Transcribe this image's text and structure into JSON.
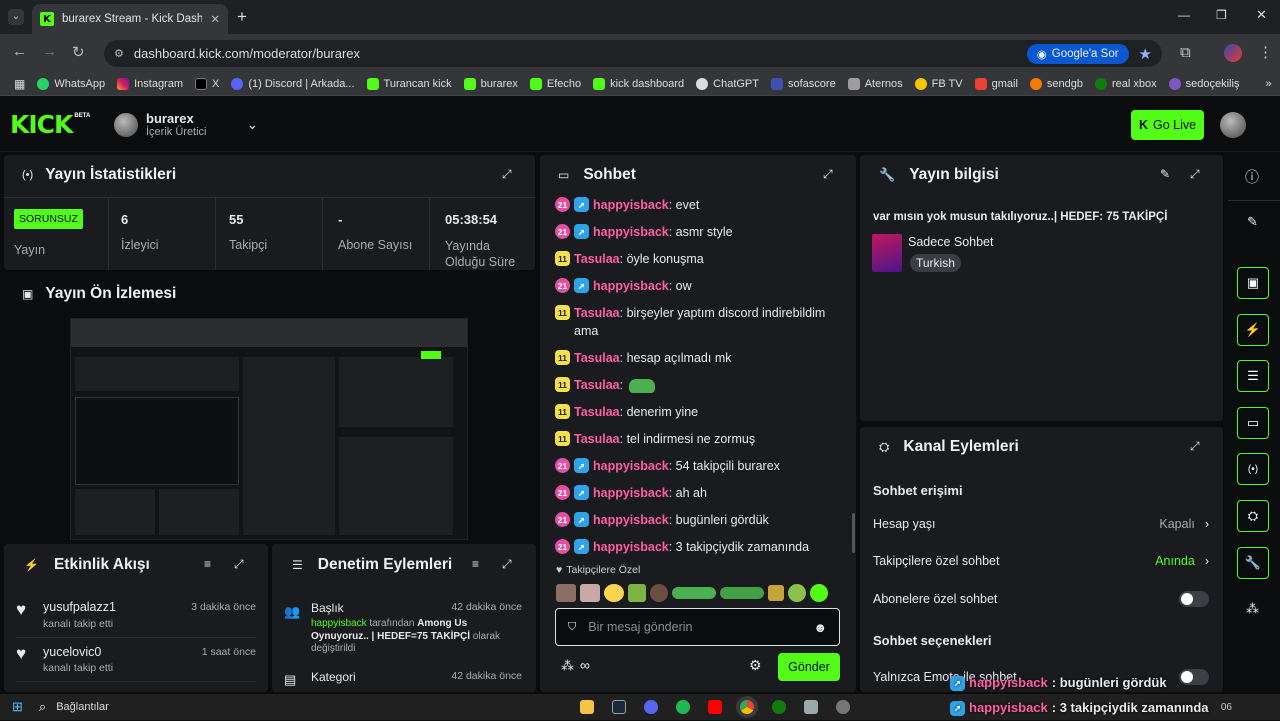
{
  "browser": {
    "tab_title": "burarex Stream - Kick Dashboar",
    "url": "dashboard.kick.com/moderator/burarex",
    "google_ask": "Google'a Sor",
    "bookmarks": [
      "WhatsApp",
      "Instagram",
      "X",
      "(1) Discord | Arkada...",
      "Turancan kick",
      "burarex",
      "Efecho",
      "kick dashboard",
      "ChatGPT",
      "sofascore",
      "Aternos",
      "FB TV",
      "gmail",
      "sendgb",
      "real xbox",
      "sedoçekiliş"
    ]
  },
  "header": {
    "logo": "KICK",
    "logo_beta": "BETA",
    "username": "burarex",
    "role": "İçerik Üretici",
    "go_live": "Go Live"
  },
  "stats": {
    "title": "Yayın İstatistikleri",
    "status_badge": "SORUNSUZ",
    "status_label": "Yayın",
    "viewers_value": "6",
    "viewers_label": "İzleyici",
    "followers_value": "55",
    "followers_label": "Takipçi",
    "subs_value": "-",
    "subs_label": "Abone Sayısı",
    "duration_value": "05:38:54",
    "duration_label": "Yayında Olduğu Süre"
  },
  "preview": {
    "title": "Yayın Ön İzlemesi"
  },
  "activity": {
    "title": "Etkinlik Akışı",
    "items": [
      {
        "user": "yusufpalazz1",
        "action": "kanalı takip etti",
        "time": "3 dakika önce"
      },
      {
        "user": "yucelovic0",
        "action": "kanalı takip etti",
        "time": "1 saat önce"
      }
    ]
  },
  "moderation": {
    "title": "Denetim Eylemleri",
    "item1_title": "Başlık",
    "item1_time": "42 dakika önce",
    "item1_user": "happyisback",
    "item1_text1": " tarafından ",
    "item1_new_title": "Among Us Oynuyoruz.. | HEDEF=75 TAKİPÇİ",
    "item1_text2": " olarak değiştirildi",
    "item2_title": "Kategori",
    "item2_time": "42 dakika önce"
  },
  "chat": {
    "title": "Sohbet",
    "messages": [
      {
        "badge": "21",
        "user": "happyisback",
        "text": ": evet"
      },
      {
        "badge": "21",
        "user": "happyisback",
        "text": ": asmr style"
      },
      {
        "badge": "11",
        "user": "Tasulaa",
        "text": ": öyle konuşma"
      },
      {
        "badge": "21",
        "user": "happyisback",
        "text": ": ow"
      },
      {
        "badge": "11",
        "user": "Tasulaa",
        "text": ": birşeyler yaptım discord indirebildim ama"
      },
      {
        "badge": "11",
        "user": "Tasulaa",
        "text": ": hesap açılmadı mk"
      },
      {
        "badge": "11",
        "user": "Tasulaa",
        "text": ": "
      },
      {
        "badge": "11",
        "user": "Tasulaa",
        "text": ": denerim yine"
      },
      {
        "badge": "11",
        "user": "Tasulaa",
        "text": ": tel indirmesi ne zormuş"
      },
      {
        "badge": "21",
        "user": "happyisback",
        "text": ": 54 takipçili burarex"
      },
      {
        "badge": "21",
        "user": "happyisback",
        "text": ": ah ah"
      },
      {
        "badge": "21",
        "user": "happyisback",
        "text": ": bugünleri gördük"
      },
      {
        "badge": "21",
        "user": "happyisback",
        "text": ": 3 takipçiydik zamanında"
      }
    ],
    "followers_only": "Takipçilere Özel",
    "placeholder": "Bir mesaj gönderin",
    "send": "Gönder"
  },
  "stream_info": {
    "title": "Yayın bilgisi",
    "stream_title": "var mısın yok musun takılıyoruz..| HEDEF: 75 TAKİPÇİ",
    "category": "Sadece Sohbet",
    "language": "Turkish"
  },
  "channel_actions": {
    "title": "Kanal Eylemleri",
    "chat_access": "Sohbet erişimi",
    "account_age": "Hesap yaşı",
    "account_age_value": "Kapalı",
    "followers_chat": "Takipçilere özel sohbet",
    "followers_chat_value": "Anında",
    "subs_chat": "Abonelere özel sohbet",
    "chat_options": "Sohbet seçenekleri",
    "emote_only": "Yalnızca Emote ile sohbet"
  },
  "overlay": {
    "line1_user": "happyisback",
    "line1_text": " : bugünleri gördük",
    "line2_user": "happyisback",
    "line2_text": " : 3 takipçiydik zamanında"
  },
  "taskbar": {
    "search": "Bağlantılar",
    "clock": "06"
  }
}
